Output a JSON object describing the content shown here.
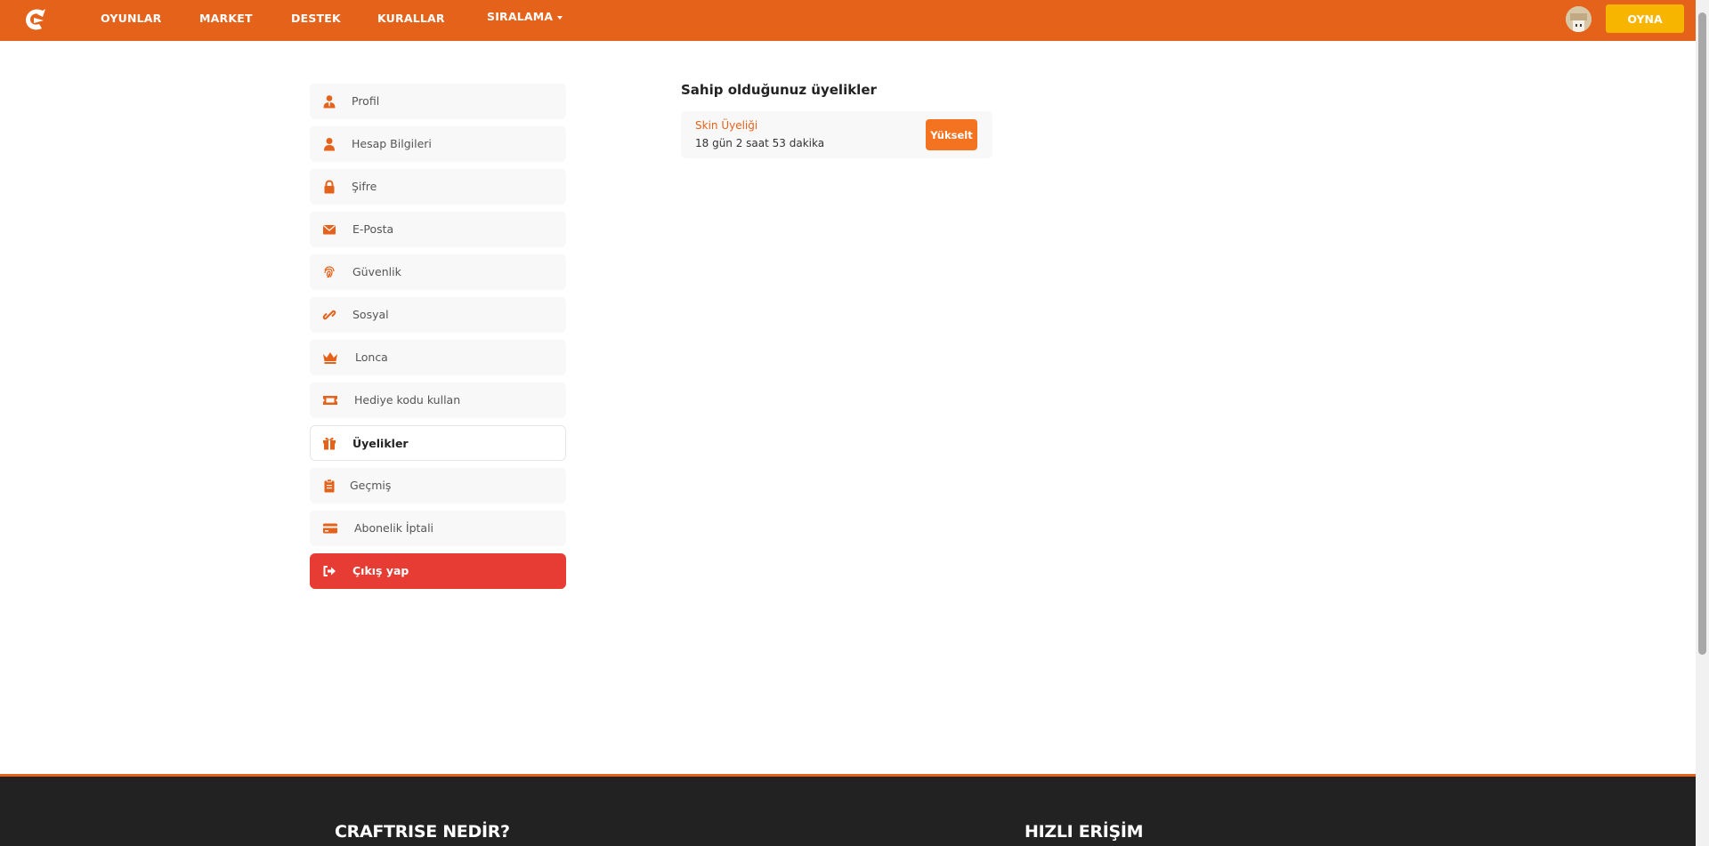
{
  "nav": {
    "links": [
      "OYUNLAR",
      "MARKET",
      "DESTEK",
      "KURALLAR",
      "SIRALAMA"
    ],
    "play_label": "OYNA"
  },
  "sidebar": {
    "items": [
      {
        "label": "Profil",
        "icon": "user-tie-icon"
      },
      {
        "label": "Hesap Bilgileri",
        "icon": "user-icon"
      },
      {
        "label": "Şifre",
        "icon": "lock-icon"
      },
      {
        "label": "E-Posta",
        "icon": "envelope-icon"
      },
      {
        "label": "Güvenlik",
        "icon": "fingerprint-icon"
      },
      {
        "label": "Sosyal",
        "icon": "link-icon"
      },
      {
        "label": "Lonca",
        "icon": "crown-icon"
      },
      {
        "label": "Hediye kodu kullan",
        "icon": "ticket-icon"
      },
      {
        "label": "Üyelikler",
        "icon": "gift-icon"
      },
      {
        "label": "Geçmiş",
        "icon": "clipboard-icon"
      },
      {
        "label": "Abonelik İptali",
        "icon": "credit-card-icon"
      },
      {
        "label": "Çıkış yap",
        "icon": "sign-out-icon"
      }
    ],
    "active": "Üyelikler"
  },
  "main": {
    "title": "Sahip olduğunuz üyelikler",
    "memberships": [
      {
        "name": "Skin Üyeliği",
        "remaining": "18 gün 2 saat 53 dakika",
        "action": "Yükselt"
      }
    ]
  },
  "footer": {
    "headings": [
      "CRAFTRISE NEDİR?",
      "HIZLI ERİŞİM"
    ]
  },
  "colors": {
    "brand": "#e5621b",
    "play_button": "#f7b500",
    "logout": "#e63c34",
    "footer_bg": "#222222"
  }
}
